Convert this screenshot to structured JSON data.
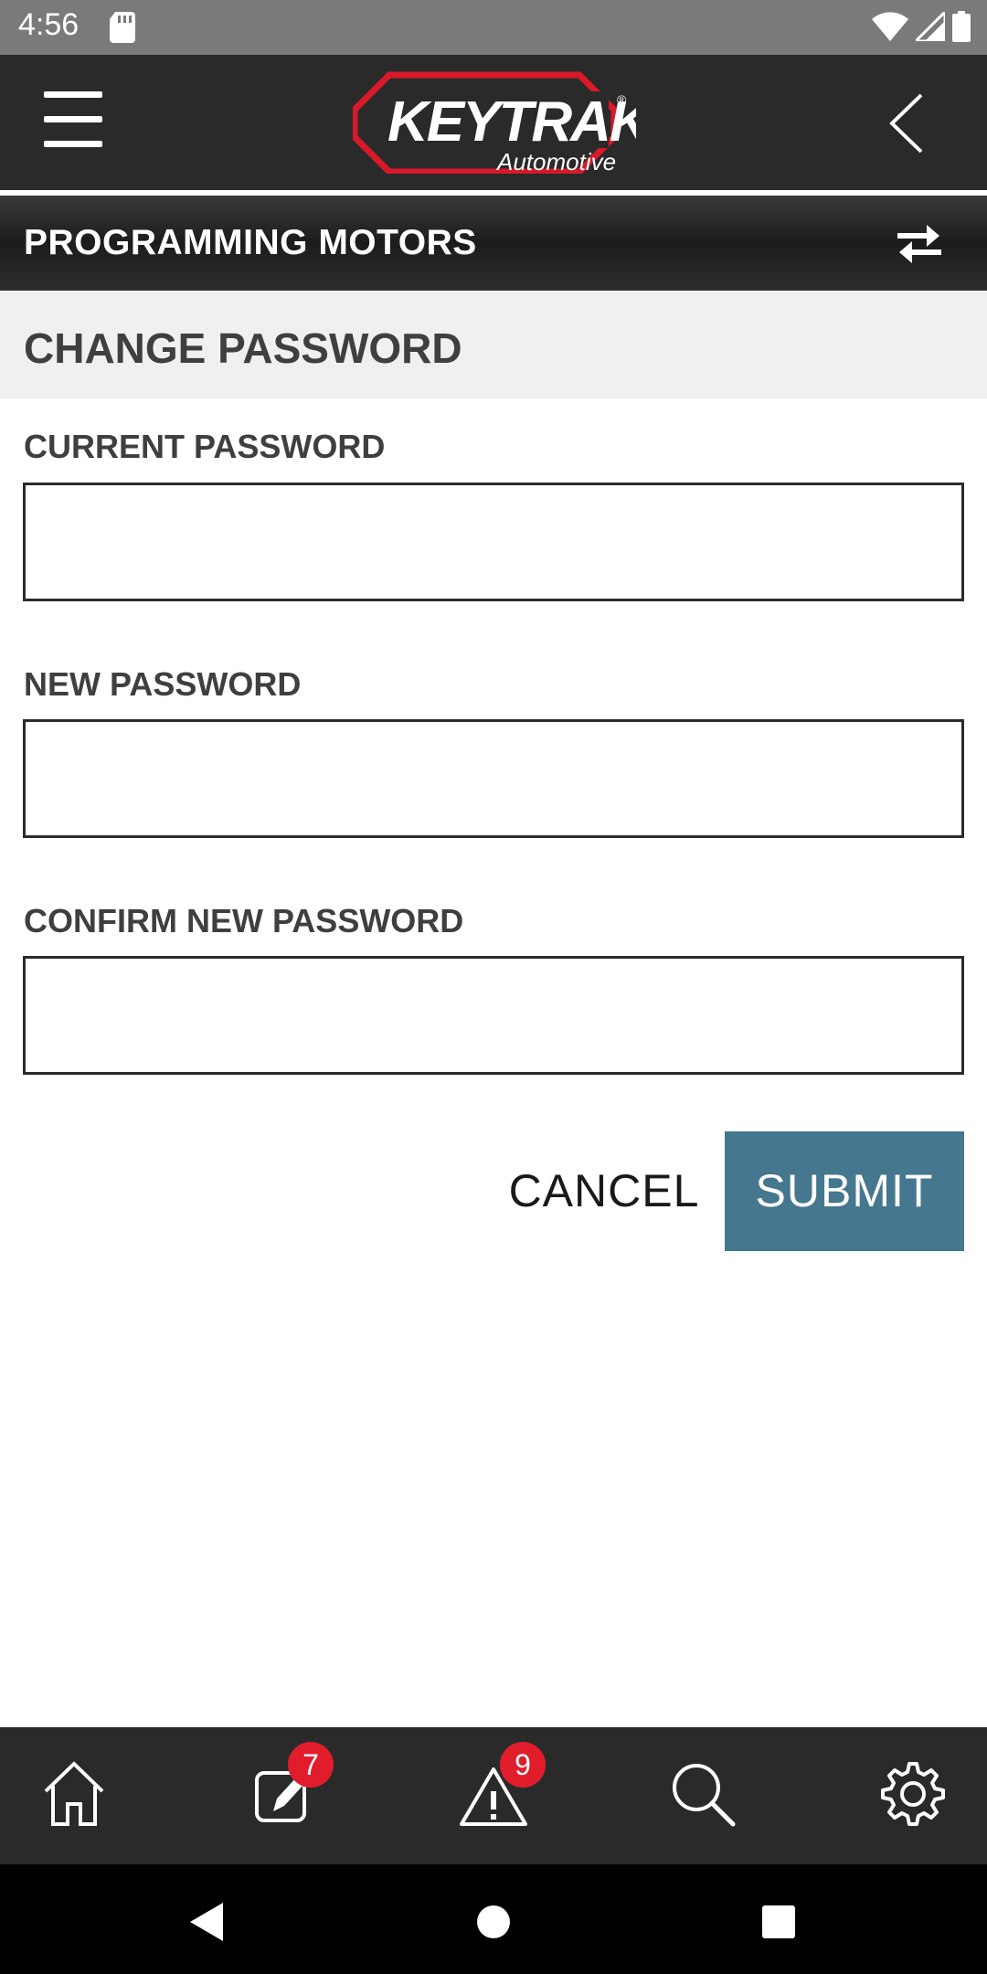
{
  "status_bar": {
    "time": "4:56"
  },
  "header": {
    "brand": "KEYTRAK",
    "brand_sub": "Automotive"
  },
  "title_bar": {
    "title": "PROGRAMMING MOTORS"
  },
  "section": {
    "title": "CHANGE PASSWORD"
  },
  "form": {
    "current_password": {
      "label": "CURRENT PASSWORD",
      "value": "",
      "placeholder": ""
    },
    "new_password": {
      "label": "NEW PASSWORD",
      "value": "",
      "placeholder": ""
    },
    "confirm_password": {
      "label": "CONFIRM NEW PASSWORD",
      "value": "",
      "placeholder": ""
    },
    "cancel_label": "CANCEL",
    "submit_label": "SUBMIT"
  },
  "tabs": [
    {
      "name": "home",
      "icon": "home-icon"
    },
    {
      "name": "edit",
      "icon": "edit-icon",
      "badge": "7"
    },
    {
      "name": "alerts",
      "icon": "warning-icon",
      "badge": "9"
    },
    {
      "name": "search",
      "icon": "search-icon"
    },
    {
      "name": "settings",
      "icon": "gear-icon"
    }
  ],
  "colors": {
    "accent": "#45778f",
    "badge": "#e21d2b",
    "logo_red": "#d7192a",
    "bar_dark": "#2a2a2a"
  }
}
